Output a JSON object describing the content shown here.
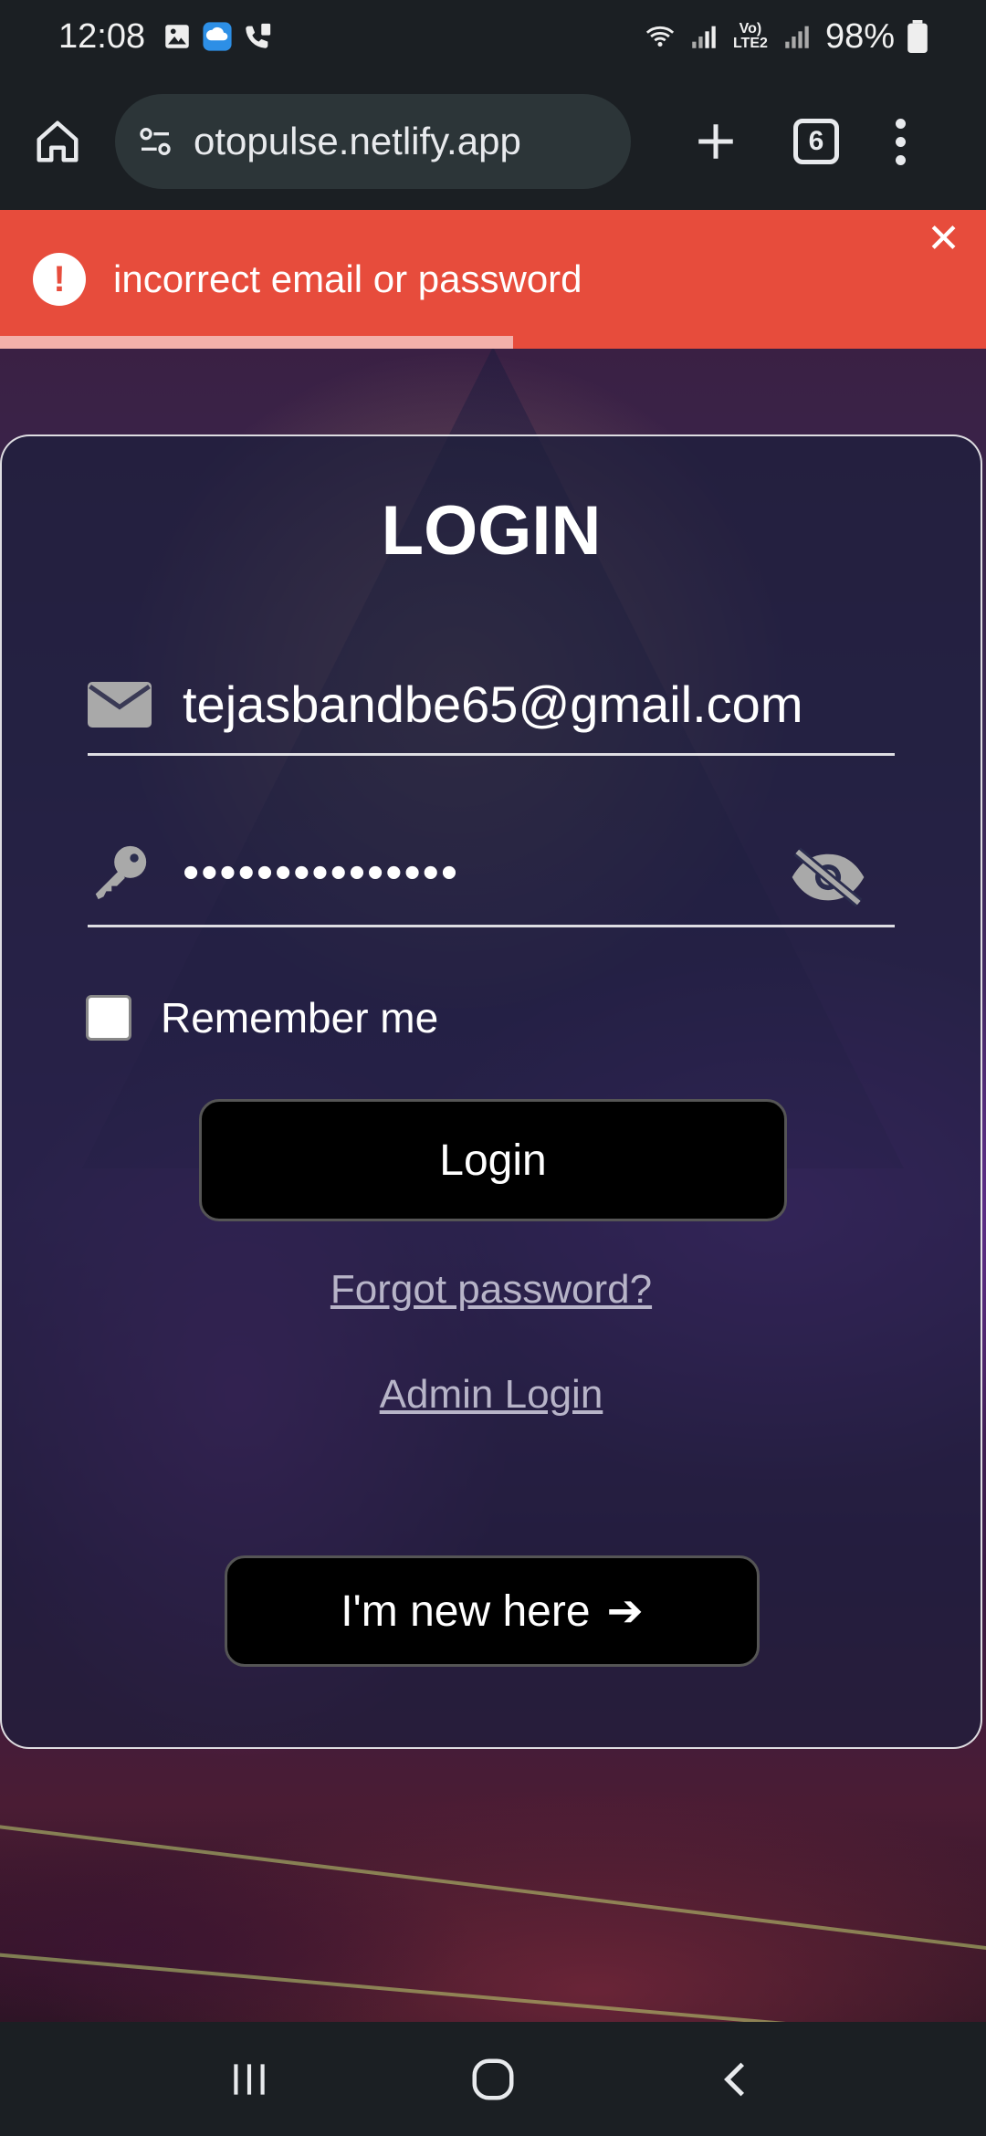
{
  "status_bar": {
    "time": "12:08",
    "battery": "98%",
    "network_label": "Vo) LTE2"
  },
  "browser": {
    "url": "otopulse.netlify.app",
    "tab_count": "6"
  },
  "toast": {
    "message": "incorrect email or password",
    "icon_glyph": "!",
    "close_glyph": "✕",
    "color": "#e74c3c",
    "progress": 0.52
  },
  "login": {
    "title": "LOGIN",
    "email_value": "tejasbandbe65@gmail.com",
    "password_mask": "•••••••••••••••",
    "remember_label": "Remember me",
    "login_button": "Login",
    "forgot_link": "Forgot password?",
    "admin_link": "Admin Login",
    "new_here_button": "I'm new here",
    "new_here_arrow": "➔"
  },
  "icons": {
    "email": "envelope-icon",
    "password": "key-icon",
    "toggle_visibility": "eye-slash-icon"
  }
}
